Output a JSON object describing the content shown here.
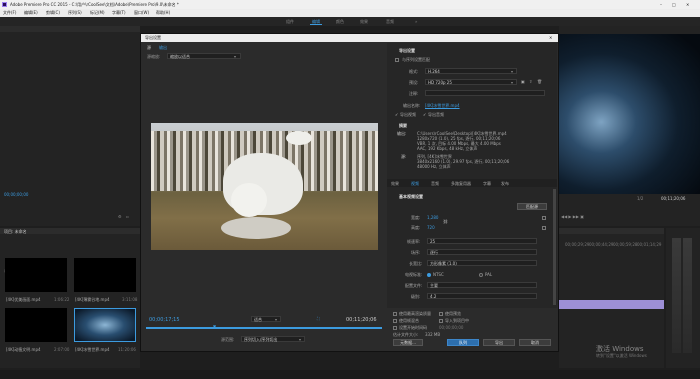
{
  "app": {
    "title": "Adobe Premiere Pro CC 2015 - C:\\用户\\rCoolSee\\文档\\Adobe\\Premiere Pro\\9.0\\未命名 *",
    "window_controls": [
      "–",
      "□",
      "✕"
    ]
  },
  "menu": [
    "文件(F)",
    "编辑(E)",
    "剪辑(C)",
    "序列(S)",
    "标记(M)",
    "字幕(T)",
    "窗口(W)",
    "帮助(H)"
  ],
  "workspaces": [
    {
      "label": "组件",
      "active": false
    },
    {
      "label": "编辑",
      "active": true
    },
    {
      "label": "颜色",
      "active": false
    },
    {
      "label": "效果",
      "active": false
    },
    {
      "label": "音频",
      "active": false
    }
  ],
  "left_panel": {
    "timecode_top": "00;00;00;00",
    "project_tab": "项目: 未命名",
    "project_file": "未命名.prproj",
    "clips": [
      {
        "name": "[4K]优美画面.mp4",
        "dur": "1:06:22"
      },
      {
        "name": "[4K]薄雾谷地.mp4",
        "dur": "3:11:08"
      },
      {
        "name": "[4K]动植文明.mp4",
        "dur": "2:07:00"
      },
      {
        "name": "[4K]冰雪世界.mp4",
        "dur": "11:20:06"
      }
    ]
  },
  "program": {
    "timecode_right": "00;11;20;06",
    "page": "1/2"
  },
  "timeline": {
    "ticks": [
      "00;00;29;29",
      "00;00;44;29",
      "00;00;59;28",
      "00;01;14;29",
      "00;01;29;29"
    ]
  },
  "taskbar": {
    "watermark_line1": "激活 Windows",
    "watermark_line2": "转到\"设置\"以激活 Windows"
  },
  "dialog": {
    "title": "导出设置",
    "tabs": [
      "源",
      "输出"
    ],
    "source_scaling_label": "源缩放:",
    "source_scaling_value": "缩放以适合",
    "timecode_left": "00;00;17;15",
    "fit_label": "适合",
    "timecode_right": "00;11;20;06",
    "range_label": "源范围:",
    "range_value": "序列切入/序列切出",
    "export_settings": {
      "header": "导出设置",
      "match_seq": "与序列设置匹配",
      "format_label": "格式:",
      "format_value": "H.264",
      "preset_label": "预设:",
      "preset_value": "HD 720p 25",
      "comments_label": "注释:",
      "output_name_label": "输出名称:",
      "output_name_value": "[4K]冰雪世界.mp4",
      "export_video": "导出视频",
      "export_audio": "导出音频",
      "summary_header": "摘要",
      "output_label": "输出:",
      "output_lines": [
        "C:\\Users\\rCoolSee\\Desktop\\[4K]冰雪世界.mp4",
        "1280x720 (1.0), 25 fps, 逐行, 00;11;20;06",
        "VBR, 1 次, 目标 4.00 Mbps, 最大 4.00 Mbps",
        "AAC, 192 Kbps, 48 kHz, 立体声"
      ],
      "source_label": "源:",
      "source_lines": [
        "序列, [4K]冰雪世界",
        "3840x2160 (1.0), 29.97 fps, 逐行, 00;11;20;06",
        "48000 Hz, 立体声"
      ]
    },
    "settings_tabs": [
      "效果",
      "视频",
      "音频",
      "多路复用器",
      "字幕",
      "发布"
    ],
    "video": {
      "header": "基本视频设置",
      "match_source": "匹配源",
      "rows": [
        {
          "label": "宽度:",
          "value": "1,280"
        },
        {
          "label": "高度:",
          "value": "720"
        },
        {
          "label": "帧速率:",
          "value": "25"
        },
        {
          "label": "场序:",
          "value": "逐行"
        },
        {
          "label": "长宽比:",
          "value": "方形像素 (1.0)"
        },
        {
          "label": "电视标准:",
          "value": "NTSC",
          "extra": "PAL"
        },
        {
          "label": "配置文件:",
          "value": "主要"
        },
        {
          "label": "级别:",
          "value": "4.2"
        }
      ]
    },
    "bottom": {
      "max_depth": "使用最高渲染质量",
      "use_previews": "使用预览",
      "use_frame_blending": "使用帧混合",
      "import_project": "导入到项目中",
      "set_start": "设置开始时间码",
      "start_tc": "00;00;00;00",
      "est_size_label": "估计文件大小:",
      "est_size_value": "332 MB"
    },
    "buttons": {
      "metadata": "元数据...",
      "queue": "队列",
      "export": "导出",
      "cancel": "取消"
    }
  }
}
